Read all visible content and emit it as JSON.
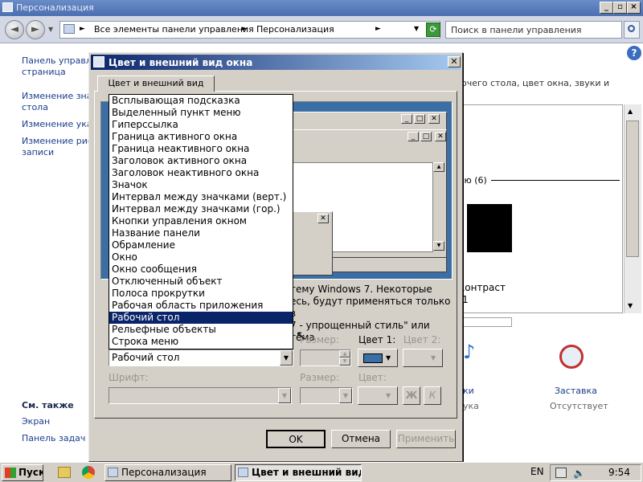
{
  "background_window": {
    "title": "Персонализация",
    "address": [
      "Все элементы панели управления",
      "Персонализация"
    ],
    "search_placeholder": "Поиск в панели управления",
    "left_links": [
      "Панель управле",
      "страница",
      "Изменение значк",
      "стола",
      "Изменение указа",
      "Изменение рисун",
      "записи"
    ],
    "see_also_title": "См. также",
    "see_also": [
      "Экран",
      "Панель задач и"
    ],
    "right_fragments": {
      "header_text": "очего стола, цвет окна, звуки и",
      "themes_count": "ью (6)",
      "contrast_label": "контраст",
      "contrast_num": "1",
      "sounds_label": "ки",
      "sounds_sub": "ука",
      "screensaver_label": "Заставка",
      "screensaver_sub": "Отсутствует"
    }
  },
  "dialog": {
    "title": "Цвет и внешний вид окна",
    "tab": "Цвет и внешний вид окна",
    "description": "тему Windows 7. Некоторые есь, будут применяться только в 7 - упрощенный стиль\" или тема",
    "description_lines": [
      "тему Windows 7. Некоторые",
      "есь, будут применяться только в",
      "7 - упрощенный стиль\" или тема"
    ],
    "element_dropdown": {
      "selected": "Рабочий стол",
      "options": [
        "Всплывающая подсказка",
        "Выделенный пункт меню",
        "Гиперссылка",
        "Граница активного окна",
        "Граница неактивного окна",
        "Заголовок активного окна",
        "Заголовок неактивного окна",
        "Значок",
        "Интервал между значками (верт.)",
        "Интервал между значками (гор.)",
        "Кнопки управления окном",
        "Название панели",
        "Обрамление",
        "Окно",
        "Окно сообщения",
        "Отключенный объект",
        "Полоса прокрутки",
        "Рабочая область приложения",
        "Рабочий стол",
        "Рельефные объекты",
        "Строка меню"
      ],
      "highlighted_index": 18
    },
    "size_label": "Размер:",
    "color1_label": "Цвет 1:",
    "color2_label": "Цвет 2:",
    "font_label": "Шрифт:",
    "font_size_label": "Размер:",
    "font_color_label": "Цвет:",
    "bold_btn": "Ж",
    "italic_btn": "К",
    "color1_value": "#3a6ea5",
    "ok": "OK",
    "cancel": "Отмена",
    "apply": "Применить"
  },
  "taskbar": {
    "start": "Пуск",
    "tasks": [
      "Персонализация",
      "Цвет и внешний вид ..."
    ],
    "lang": "EN",
    "clock": "9:54"
  }
}
